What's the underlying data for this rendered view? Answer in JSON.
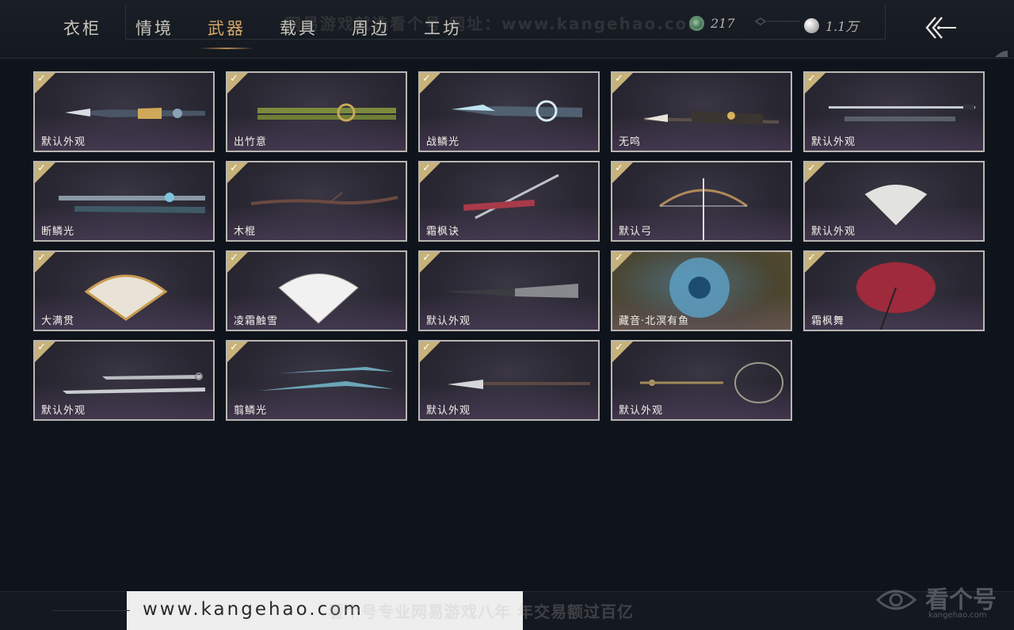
{
  "tabs": [
    {
      "label": "衣柜",
      "active": false
    },
    {
      "label": "情境",
      "active": false
    },
    {
      "label": "武器",
      "active": true
    },
    {
      "label": "载具",
      "active": false
    },
    {
      "label": "周边",
      "active": false
    },
    {
      "label": "工坊",
      "active": false
    }
  ],
  "watermark_top": "网易游戏就选看个号  网址：www.kangehao.com",
  "currency": {
    "jade": {
      "value": "217",
      "icon": "jade-coin-icon"
    },
    "silver": {
      "value": "1.1万",
      "icon": "silver-coin-icon"
    }
  },
  "back_icon": "back-arrow-icon",
  "items": [
    {
      "name": "默认外观",
      "owned": true,
      "weapon": "twin-blade-staff"
    },
    {
      "name": "出竹意",
      "owned": true,
      "weapon": "bamboo-staff"
    },
    {
      "name": "战鳞光",
      "owned": true,
      "weapon": "dragon-blade"
    },
    {
      "name": "无鸣",
      "owned": true,
      "weapon": "ornate-spear"
    },
    {
      "name": "默认外观",
      "owned": true,
      "weapon": "long-sword"
    },
    {
      "name": "断鳞光",
      "owned": true,
      "weapon": "jade-sword"
    },
    {
      "name": "木棍",
      "owned": true,
      "weapon": "wooden-stick"
    },
    {
      "name": "霜枫诀",
      "owned": true,
      "weapon": "red-sword"
    },
    {
      "name": "默认弓",
      "owned": true,
      "weapon": "bow"
    },
    {
      "name": "默认外观",
      "owned": true,
      "weapon": "fan"
    },
    {
      "name": "大满贯",
      "owned": true,
      "weapon": "gold-fan"
    },
    {
      "name": "凌霜触雪",
      "owned": true,
      "weapon": "white-fan"
    },
    {
      "name": "默认外观",
      "owned": true,
      "weapon": "closed-umbrella"
    },
    {
      "name": "藏音·北溟有鱼",
      "owned": true,
      "weapon": "blue-umbrella"
    },
    {
      "name": "霜枫舞",
      "owned": true,
      "weapon": "red-umbrella"
    },
    {
      "name": "默认外观",
      "owned": true,
      "weapon": "twin-sabers"
    },
    {
      "name": "翦鳞光",
      "owned": true,
      "weapon": "twin-jade-blades"
    },
    {
      "name": "默认外观",
      "owned": true,
      "weapon": "long-glaive"
    },
    {
      "name": "默认外观",
      "owned": true,
      "weapon": "rope-dart"
    }
  ],
  "footer": {
    "url": "www.kangehao.com",
    "slogan": "看个号专业网易游戏八年  年交易额过百亿",
    "logo_name": "看个号",
    "logo_sub": "kangehao.com"
  }
}
